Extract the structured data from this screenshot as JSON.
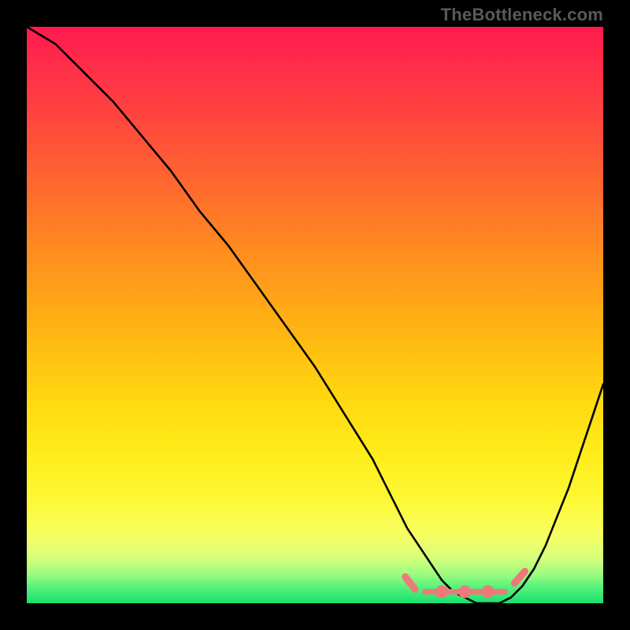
{
  "watermark": "TheBottleneck.com",
  "chart_data": {
    "type": "line",
    "title": "",
    "xlabel": "",
    "ylabel": "",
    "xlim": [
      0,
      100
    ],
    "ylim": [
      0,
      100
    ],
    "grid": false,
    "legend": false,
    "series": [
      {
        "name": "bottleneck-curve",
        "color": "#000000",
        "x": [
          0,
          5,
          10,
          15,
          20,
          25,
          30,
          35,
          40,
          45,
          50,
          55,
          60,
          62,
          64,
          66,
          68,
          70,
          72,
          74,
          76,
          78,
          80,
          82,
          84,
          86,
          88,
          90,
          92,
          94,
          96,
          98,
          100
        ],
        "values": [
          100,
          97,
          92,
          87,
          81,
          75,
          68,
          62,
          55,
          48,
          41,
          33,
          25,
          21,
          17,
          13,
          10,
          7,
          4,
          2,
          1,
          0,
          0,
          0,
          1,
          3,
          6,
          10,
          15,
          20,
          26,
          32,
          38
        ]
      },
      {
        "name": "bottleneck-floor-markers",
        "color": "#ed7a78",
        "style": "dash-dot",
        "x": [
          66,
          68,
          70,
          72,
          74,
          76,
          78,
          80,
          82,
          84,
          86
        ],
        "values": [
          2,
          2,
          2,
          2,
          2,
          2,
          2,
          2,
          2,
          3,
          5
        ]
      }
    ],
    "gradient_stops": [
      {
        "pos": 0.0,
        "color": "#ff1a4d"
      },
      {
        "pos": 0.06,
        "color": "#ff2b4a"
      },
      {
        "pos": 0.14,
        "color": "#ff4040"
      },
      {
        "pos": 0.28,
        "color": "#ff6a2e"
      },
      {
        "pos": 0.4,
        "color": "#ff8f1e"
      },
      {
        "pos": 0.52,
        "color": "#ffb313"
      },
      {
        "pos": 0.64,
        "color": "#ffd610"
      },
      {
        "pos": 0.74,
        "color": "#ffec1a"
      },
      {
        "pos": 0.82,
        "color": "#fdf835"
      },
      {
        "pos": 0.88,
        "color": "#f7fe60"
      },
      {
        "pos": 0.92,
        "color": "#d8ff7a"
      },
      {
        "pos": 0.95,
        "color": "#9bfb80"
      },
      {
        "pos": 0.975,
        "color": "#4ff07a"
      },
      {
        "pos": 1.0,
        "color": "#18e06e"
      }
    ]
  }
}
